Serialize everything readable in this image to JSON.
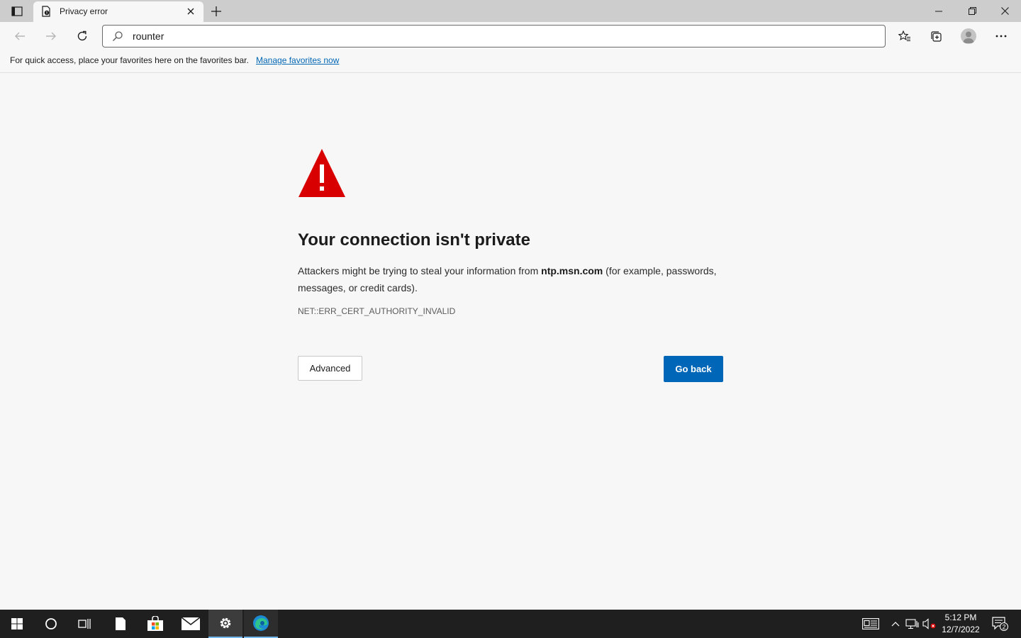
{
  "tabs": [
    {
      "title": "Privacy error",
      "icon": "page-warning-icon",
      "active": true
    }
  ],
  "toolbar": {
    "omnibox_value": "rounter",
    "icons": [
      "back-icon",
      "forward-icon",
      "refresh-icon",
      "search-icon",
      "favorites-icon",
      "collections-icon",
      "profile-icon",
      "more-icon"
    ]
  },
  "favorites_bar": {
    "message": "For quick access, place your favorites here on the favorites bar.",
    "link": "Manage favorites now"
  },
  "error_page": {
    "icon": "warning-triangle-icon",
    "heading": "Your connection isn't private",
    "desc_before": "Attackers might be trying to steal your information from ",
    "host": "ntp.msn.com",
    "desc_after": " (for example, passwords, messages, or credit cards).",
    "error_code": "NET::ERR_CERT_AUTHORITY_INVALID",
    "advanced_label": "Advanced",
    "go_back_label": "Go back"
  },
  "taskbar": {
    "apps": [
      "start-icon",
      "search-circle-icon",
      "task-view-icon",
      "file-icon",
      "store-icon",
      "mail-icon",
      "settings-icon",
      "edge-icon"
    ],
    "time": "5:12 PM",
    "date": "12/7/2022",
    "notification_count": "2"
  },
  "colors": {
    "accent": "#0067b8",
    "warning": "#d80000",
    "link": "#0066b4",
    "taskbar": "#1f1f1f"
  }
}
